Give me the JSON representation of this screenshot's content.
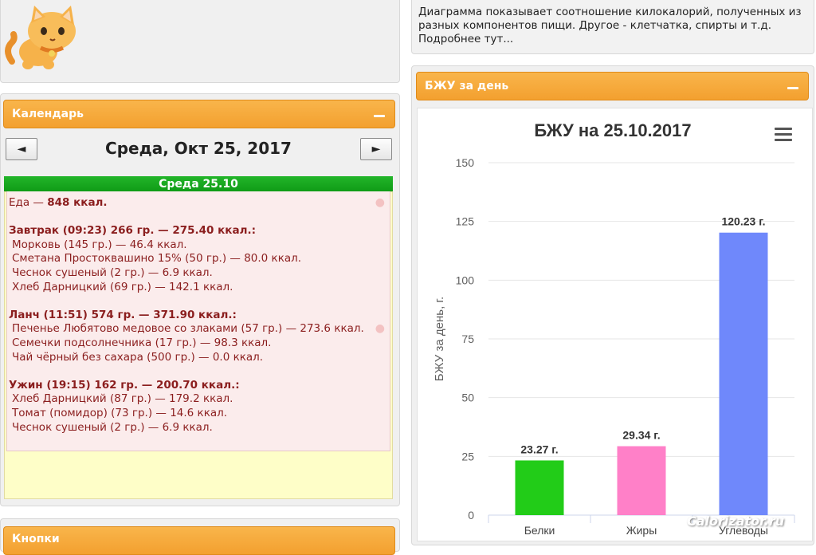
{
  "info_text": [
    "Диаграмма показывает соотношение килокалорий, полученных из",
    "разных компонентов пищи. Другое - клетчатка, спирты и т.д.",
    "Подробнее тут..."
  ],
  "calendar": {
    "header": "Календарь",
    "prev_label": "◄",
    "next_label": "►",
    "date_title": "Среда, Окт 25, 2017",
    "day_bar": "Среда 25.10"
  },
  "food_total": {
    "label": "Еда — ",
    "value": "848 ккал."
  },
  "meals": [
    {
      "header": "Завтрак (09:23) 266 гр. — 275.40 ккал.:",
      "items": [
        "Морковь (145 гр.) — 46.4 ккал.",
        "Сметана Простоквашино 15% (50 гр.) — 80.0 ккал.",
        "Чеснок сушеный (2 гр.) — 6.9 ккал.",
        "Хлеб Дарницкий (69 гр.) — 142.1 ккал."
      ]
    },
    {
      "header": "Ланч (11:51) 574 гр. — 371.90 ккал.:",
      "items": [
        "Печенье Любятово медовое со злаками (57 гр.) — 273.6 ккал.",
        "Семечки подсолнечника (17 гр.) — 98.3 ккал.",
        "Чай чёрный без сахара (500 гр.) — 0.0 ккал."
      ]
    },
    {
      "header": "Ужин (19:15) 162 гр. — 200.70 ккал.:",
      "items": [
        "Хлеб Дарницкий (87 гр.) — 179.2 ккал.",
        "Томат (помидор) (73 гр.) — 14.6 ккал.",
        "Чеснок сушеный (2 гр.) — 6.9 ккал."
      ]
    }
  ],
  "bottom_panel_header": "Кнопки",
  "bju_panel_header": "БЖУ за день",
  "watermark": "Calorizator.ru",
  "colors": {
    "orange": "#f5a733",
    "green": "#15a81c",
    "belki": "#22cc18",
    "zhiry": "#ff80c8",
    "uglevody": "#6f88fb"
  },
  "chart_data": {
    "type": "bar",
    "title": "БЖУ на 25.10.2017",
    "ylabel": "БЖУ за день, г.",
    "xlabel": "",
    "categories": [
      "Белки",
      "Жиры",
      "Углеводы"
    ],
    "values": [
      23.27,
      29.34,
      120.23
    ],
    "data_labels": [
      "23.27 г.",
      "29.34 г.",
      "120.23 г."
    ],
    "bar_colors": [
      "#22cc18",
      "#ff80c8",
      "#6f88fb"
    ],
    "ylim": [
      0,
      150
    ],
    "yticks": [
      0,
      25,
      50,
      75,
      100,
      125,
      150
    ],
    "grid": true,
    "legend": "none"
  }
}
